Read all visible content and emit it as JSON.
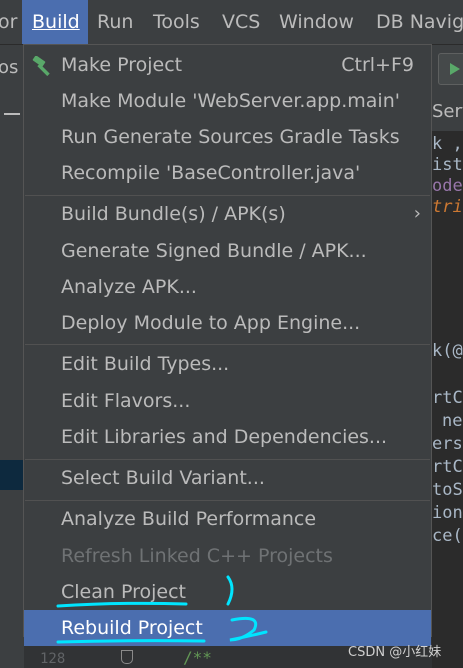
{
  "menubar": {
    "items": [
      {
        "label": "or"
      },
      {
        "label": "Build",
        "active": true
      },
      {
        "label": "Run"
      },
      {
        "label": "Tools"
      },
      {
        "label": "VCS"
      },
      {
        "label": "Window"
      },
      {
        "label": "DB Navig"
      }
    ]
  },
  "background": {
    "left_fragment": "os",
    "tab_fragment": "Serv",
    "code_fragments": [
      "k ,",
      "ist",
      "odel",
      "tri",
      "k(@",
      "rtC",
      "ne",
      "ers",
      "rtC",
      "toS",
      "ion",
      "ce("
    ],
    "line_number": "128",
    "comment": "/**"
  },
  "build_menu": {
    "items": [
      {
        "label": "Make Project",
        "shortcut": "Ctrl+F9",
        "icon": "hammer-icon"
      },
      {
        "label": "Make Module 'WebServer.app.main'"
      },
      {
        "label": "Run Generate Sources Gradle Tasks"
      },
      {
        "label": "Recompile 'BaseController.java'"
      },
      {
        "label": "Build Bundle(s) / APK(s)",
        "submenu": true
      },
      {
        "label": "Generate Signed Bundle / APK..."
      },
      {
        "label": "Analyze APK..."
      },
      {
        "label": "Deploy Module to App Engine..."
      },
      {
        "label": "Edit Build Types..."
      },
      {
        "label": "Edit Flavors..."
      },
      {
        "label": "Edit Libraries and Dependencies..."
      },
      {
        "label": "Select Build Variant..."
      },
      {
        "label": "Analyze Build Performance"
      },
      {
        "label": "Refresh Linked C++ Projects",
        "disabled": true
      },
      {
        "label": "Clean Project"
      },
      {
        "label": "Rebuild Project",
        "highlighted": true
      }
    ],
    "submenu_arrow": "›"
  },
  "colors": {
    "menu_bg": "#3c3f41",
    "highlight": "#4b6eaf",
    "annotation": "#00e5ff"
  },
  "watermark": "CSDN @小红妹"
}
